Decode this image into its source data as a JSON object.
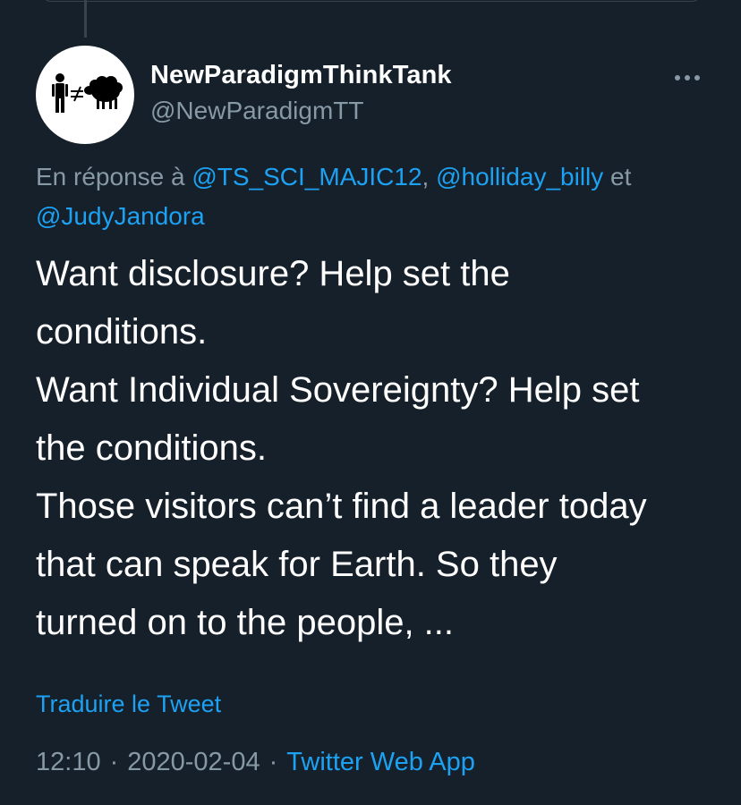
{
  "author": {
    "display_name": "NewParadigmThinkTank",
    "handle": "@NewParadigmTT",
    "avatar_icon": "person-not-equal-sheep-icon"
  },
  "more_icon": "more-horizontal-icon",
  "reply": {
    "prefix": "En réponse à ",
    "mention_1": "@TS_SCI_MAJIC12",
    "sep_1": ", ",
    "mention_2": "@holliday_billy",
    "sep_2": " et",
    "mention_3": "@JudyJandora"
  },
  "tweet": {
    "lines": [
      "Want disclosure? Help set the",
      "conditions.",
      "Want Individual Sovereignty? Help set",
      "the conditions.",
      "Those visitors can’t find a leader today",
      "that can speak for Earth. So they",
      "turned on to the people, ..."
    ]
  },
  "translate_label": "Traduire le Tweet",
  "meta": {
    "time": "12:10",
    "date": "2020-02-04",
    "separator": "·",
    "source": "Twitter Web App"
  },
  "colors": {
    "background": "#15202b",
    "text": "#ffffff",
    "secondary_text": "#8899a6",
    "link": "#1da1f2",
    "border": "#38444d"
  }
}
